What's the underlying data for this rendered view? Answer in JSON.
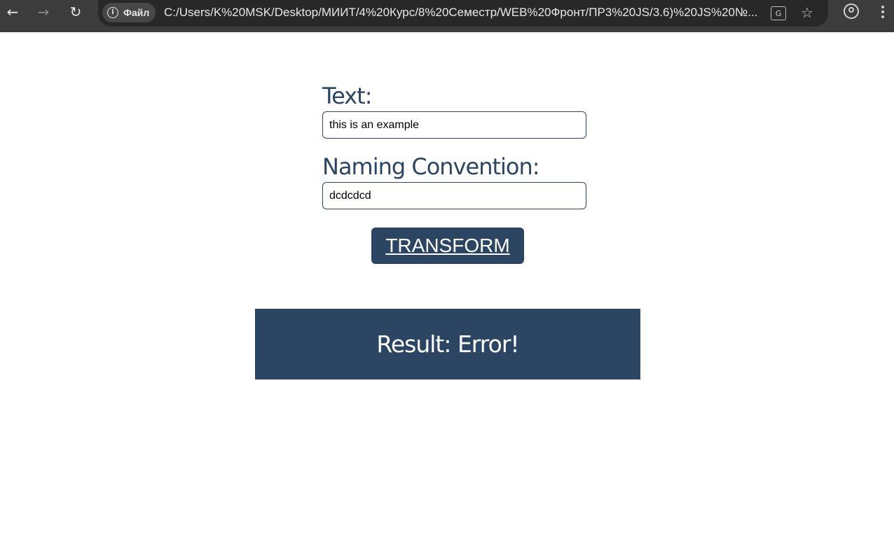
{
  "browser": {
    "site_chip_label": "Файл",
    "url": "C:/Users/K%20MSK/Desktop/МИИТ/4%20Курс/8%20Семестр/WEB%20Фронт/ПР3%20JS/3.6)%20JS%20№..."
  },
  "form": {
    "text_label": "Text:",
    "text_value": "this is an example",
    "naming_label": "Naming Convention:",
    "naming_value": "dcdcdcd",
    "transform_label": "TRANSFORM"
  },
  "result": {
    "text": "Result: Error!"
  },
  "colors": {
    "accent": "#2b4562",
    "browser_bar": "#3c3c3c"
  }
}
